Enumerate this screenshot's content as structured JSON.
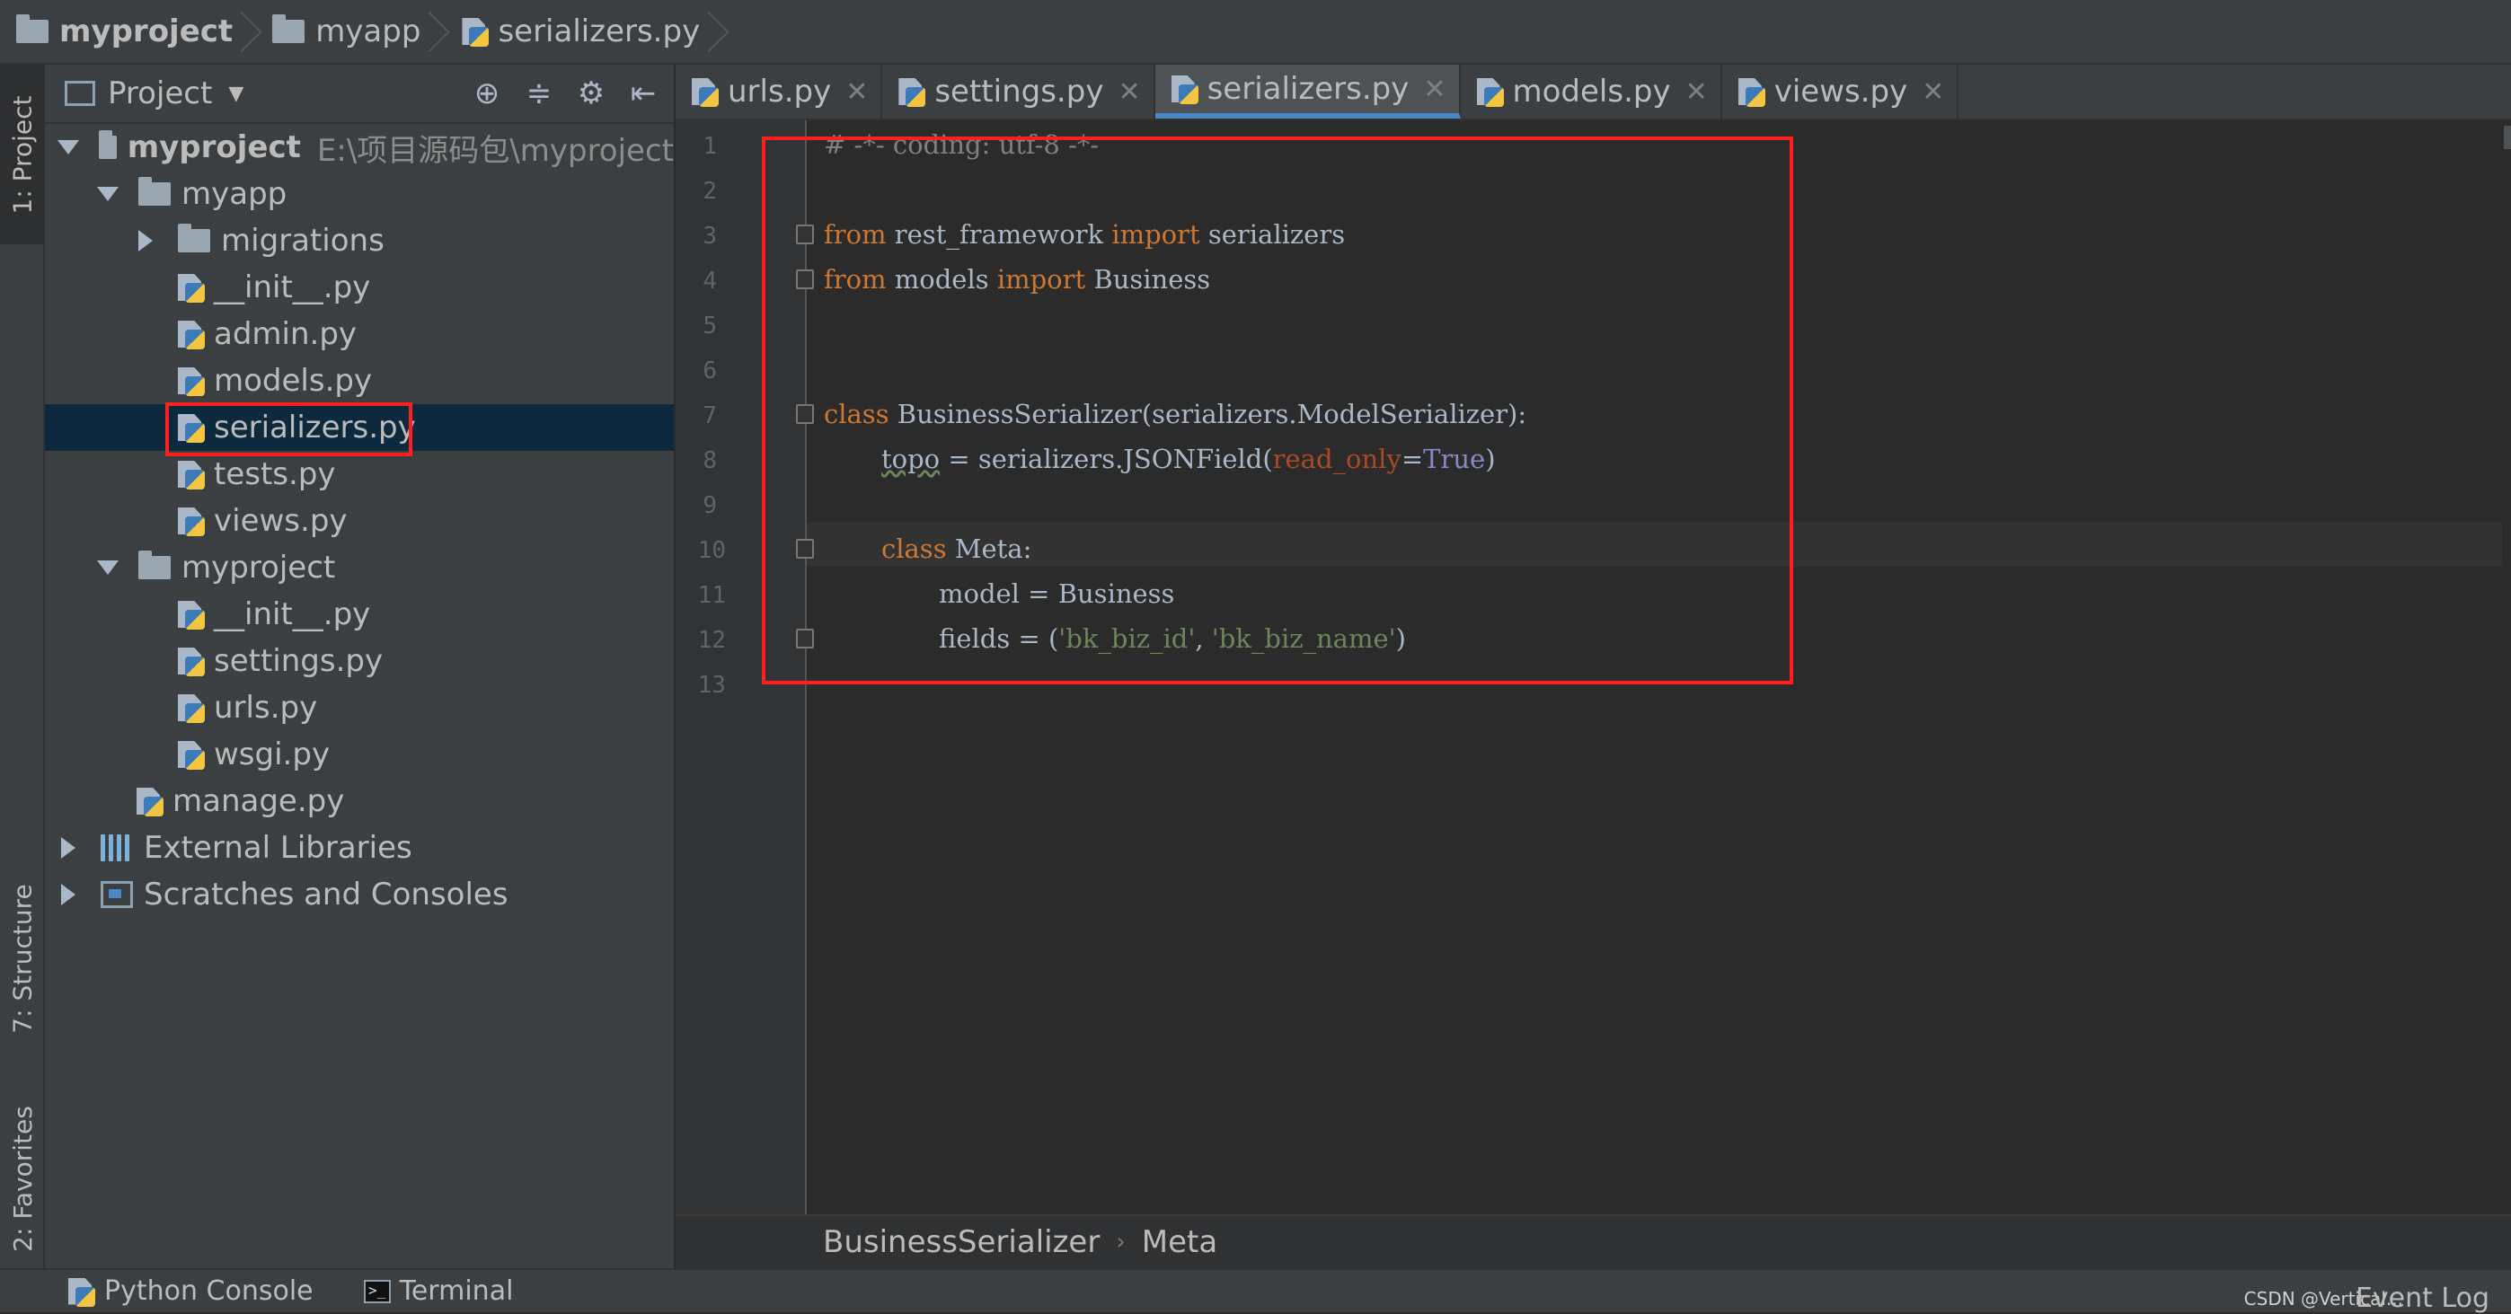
{
  "navbar": {
    "crumbs": [
      "myproject",
      "myapp",
      "serializers.py"
    ]
  },
  "left_strip": {
    "project_tab": "1: Project",
    "structure_tab": "7: Structure",
    "favorites_tab": "2: Favorites"
  },
  "project_panel": {
    "title": "Project",
    "tree": [
      {
        "label": "myproject",
        "extra": "E:\\项目源码包\\myproject"
      },
      {
        "label": "myapp"
      },
      {
        "label": "migrations"
      },
      {
        "label": "__init__.py"
      },
      {
        "label": "admin.py"
      },
      {
        "label": "models.py"
      },
      {
        "label": "serializers.py"
      },
      {
        "label": "tests.py"
      },
      {
        "label": "views.py"
      },
      {
        "label": "myproject"
      },
      {
        "label": "__init__.py"
      },
      {
        "label": "settings.py"
      },
      {
        "label": "urls.py"
      },
      {
        "label": "wsgi.py"
      },
      {
        "label": "manage.py"
      },
      {
        "label": "External Libraries"
      },
      {
        "label": "Scratches and Consoles"
      }
    ]
  },
  "tabs": [
    {
      "label": "urls.py",
      "active": false
    },
    {
      "label": "settings.py",
      "active": false
    },
    {
      "label": "serializers.py",
      "active": true
    },
    {
      "label": "models.py",
      "active": false
    },
    {
      "label": "views.py",
      "active": false
    }
  ],
  "editor": {
    "line_numbers": [
      "1",
      "2",
      "3",
      "4",
      "5",
      "6",
      "7",
      "8",
      "9",
      "10",
      "11",
      "12",
      "13"
    ],
    "lines": {
      "l1": "# -*- coding: utf-8 -*-",
      "l3_from": "from",
      "l3_mod": " rest_framework ",
      "l3_import": "import",
      "l3_name": " serializers",
      "l4_from": "from",
      "l4_mod": " models ",
      "l4_import": "import",
      "l4_name": " Business",
      "l7_class": "class",
      "l7_rest": " BusinessSerializer(serializers.ModelSerializer):",
      "l8_var": "topo",
      "l8_mid": " = serializers.JSONField(",
      "l8_param": "read_only",
      "l8_eq": "=",
      "l8_true": "True",
      "l8_close": ")",
      "l10_class": "class",
      "l10_rest": " Meta:",
      "l11": "model = Business",
      "l12_a": "fields = (",
      "l12_s1": "'bk_biz_id'",
      "l12_c": ", ",
      "l12_s2": "'bk_biz_name'",
      "l12_b": ")"
    },
    "breadcrumb": [
      "BusinessSerializer",
      "Meta"
    ]
  },
  "bottom_bar": {
    "python_console": "Python Console",
    "terminal": "Terminal",
    "event_log": "Event Log",
    "watermark": "CSDN @Vertical..."
  },
  "colors": {
    "highlight_box": "#ff1f1f",
    "keyword": "#cc7832",
    "string": "#6a8759",
    "selection": "#0d293e"
  }
}
